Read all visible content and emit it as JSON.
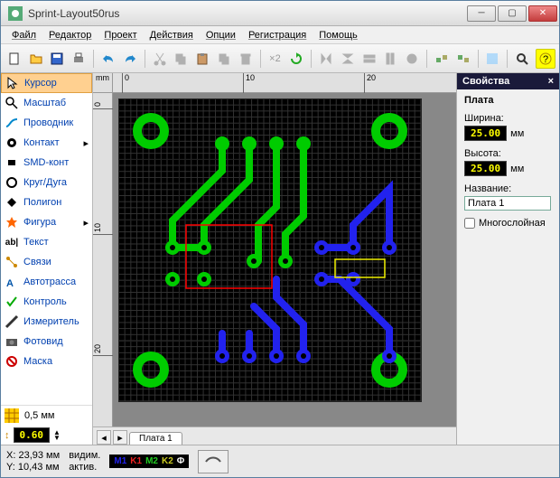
{
  "window": {
    "title": "Sprint-Layout50rus"
  },
  "menu": [
    "Файл",
    "Редактор",
    "Проект",
    "Действия",
    "Опции",
    "Регистрация",
    "Помощь"
  ],
  "tools": [
    {
      "icon": "cursor",
      "label": "Курсор",
      "sel": true
    },
    {
      "icon": "zoom",
      "label": "Масштаб"
    },
    {
      "icon": "trace",
      "label": "Проводник"
    },
    {
      "icon": "pad",
      "label": "Контакт"
    },
    {
      "icon": "smd",
      "label": "SMD-конт"
    },
    {
      "icon": "circle",
      "label": "Круг/Дуга"
    },
    {
      "icon": "poly",
      "label": "Полигон"
    },
    {
      "icon": "shape",
      "label": "Фигура"
    },
    {
      "icon": "text",
      "label": "Текст"
    },
    {
      "icon": "conn",
      "label": "Связи"
    },
    {
      "icon": "auto",
      "label": "Автотрасса"
    },
    {
      "icon": "check",
      "label": "Контроль"
    },
    {
      "icon": "meas",
      "label": "Измеритель"
    },
    {
      "icon": "photo",
      "label": "Фотовид"
    },
    {
      "icon": "mask",
      "label": "Маска"
    }
  ],
  "grid": {
    "label": "0,5 мм",
    "value": "0.60"
  },
  "rulers": {
    "unit": "mm",
    "ticks": [
      "0",
      "10",
      "20"
    ]
  },
  "tab": {
    "name": "Плата 1"
  },
  "props": {
    "header": "Свойства",
    "title": "Плата",
    "width_label": "Ширина:",
    "width_val": "25.00",
    "width_unit": "мм",
    "height_label": "Высота:",
    "height_val": "25.00",
    "height_unit": "мм",
    "name_label": "Название:",
    "name_val": "Плата 1",
    "multi_label": "Многослойная"
  },
  "status": {
    "x_label": "X:",
    "x_val": "23,93 мм",
    "y_label": "Y:",
    "y_val": "10,43 мм",
    "vis": "видим.",
    "act": "актив.",
    "layers": [
      "M1",
      "K1",
      "M2",
      "K2",
      "Ф"
    ]
  },
  "icons": {
    "new": "new",
    "open": "open",
    "save": "save",
    "print": "print",
    "undo": "undo",
    "redo": "redo",
    "cut": "cut",
    "copy": "copy",
    "paste": "paste",
    "dup": "dup",
    "del": "del",
    "x2": "×2",
    "rot": "rot",
    "mirh": "mirh",
    "mirv": "mirv",
    "alignh": "alignh",
    "alignv": "alignv",
    "snap": "snap",
    "lock": "lock",
    "trans": "trans",
    "zoom": "zoom",
    "info": "info"
  }
}
